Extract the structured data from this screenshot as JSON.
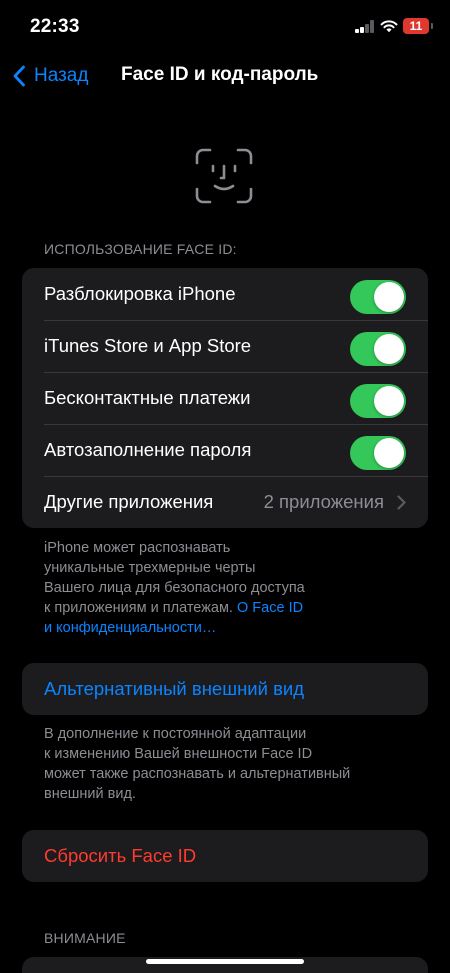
{
  "status_bar": {
    "time": "22:33",
    "battery_level": "11",
    "signal_icon": "cellular-signal-icon",
    "wifi_icon": "wifi-icon",
    "battery_color": "#e0382e"
  },
  "nav": {
    "back_label": "Назад",
    "back_icon": "chevron-left-icon",
    "title": "Face ID и код-пароль"
  },
  "header_icon": "face-id-icon",
  "face_id_usage": {
    "header": "ИСПОЛЬЗОВАНИЕ FACE ID:",
    "rows": [
      {
        "label": "Разблокировка iPhone",
        "on": true
      },
      {
        "label": "iTunes Store и App Store",
        "on": true
      },
      {
        "label": "Бесконтактные платежи",
        "on": true
      },
      {
        "label": "Автозаполнение пароля",
        "on": true
      }
    ],
    "other_apps": {
      "label": "Другие приложения",
      "value": "2 приложения"
    },
    "footer_lines": [
      "iPhone может распознавать",
      "уникальные трехмерные черты",
      "Вашего лица для безопасного доступа",
      "к приложениям и платежам. "
    ],
    "footer_link_lines": [
      "O Face ID",
      "и конфиденциальности…"
    ]
  },
  "alternate_appearance": {
    "label": "Альтернативный внешний вид",
    "footer_lines": [
      "В дополнение к постоянной адаптации",
      "к изменению Вашей внешности Face ID",
      "может также распознавать и альтернативный",
      "внешний вид."
    ]
  },
  "reset": {
    "label": "Сбросить Face ID"
  },
  "attention": {
    "header": "ВНИМАНИЕ"
  },
  "colors": {
    "background": "#000000",
    "cell_background": "#1c1c1e",
    "accent_blue": "#0a84ff",
    "toggle_green": "#34c759",
    "destructive_red": "#ff3b30",
    "secondary_text": "#8d8d93"
  }
}
